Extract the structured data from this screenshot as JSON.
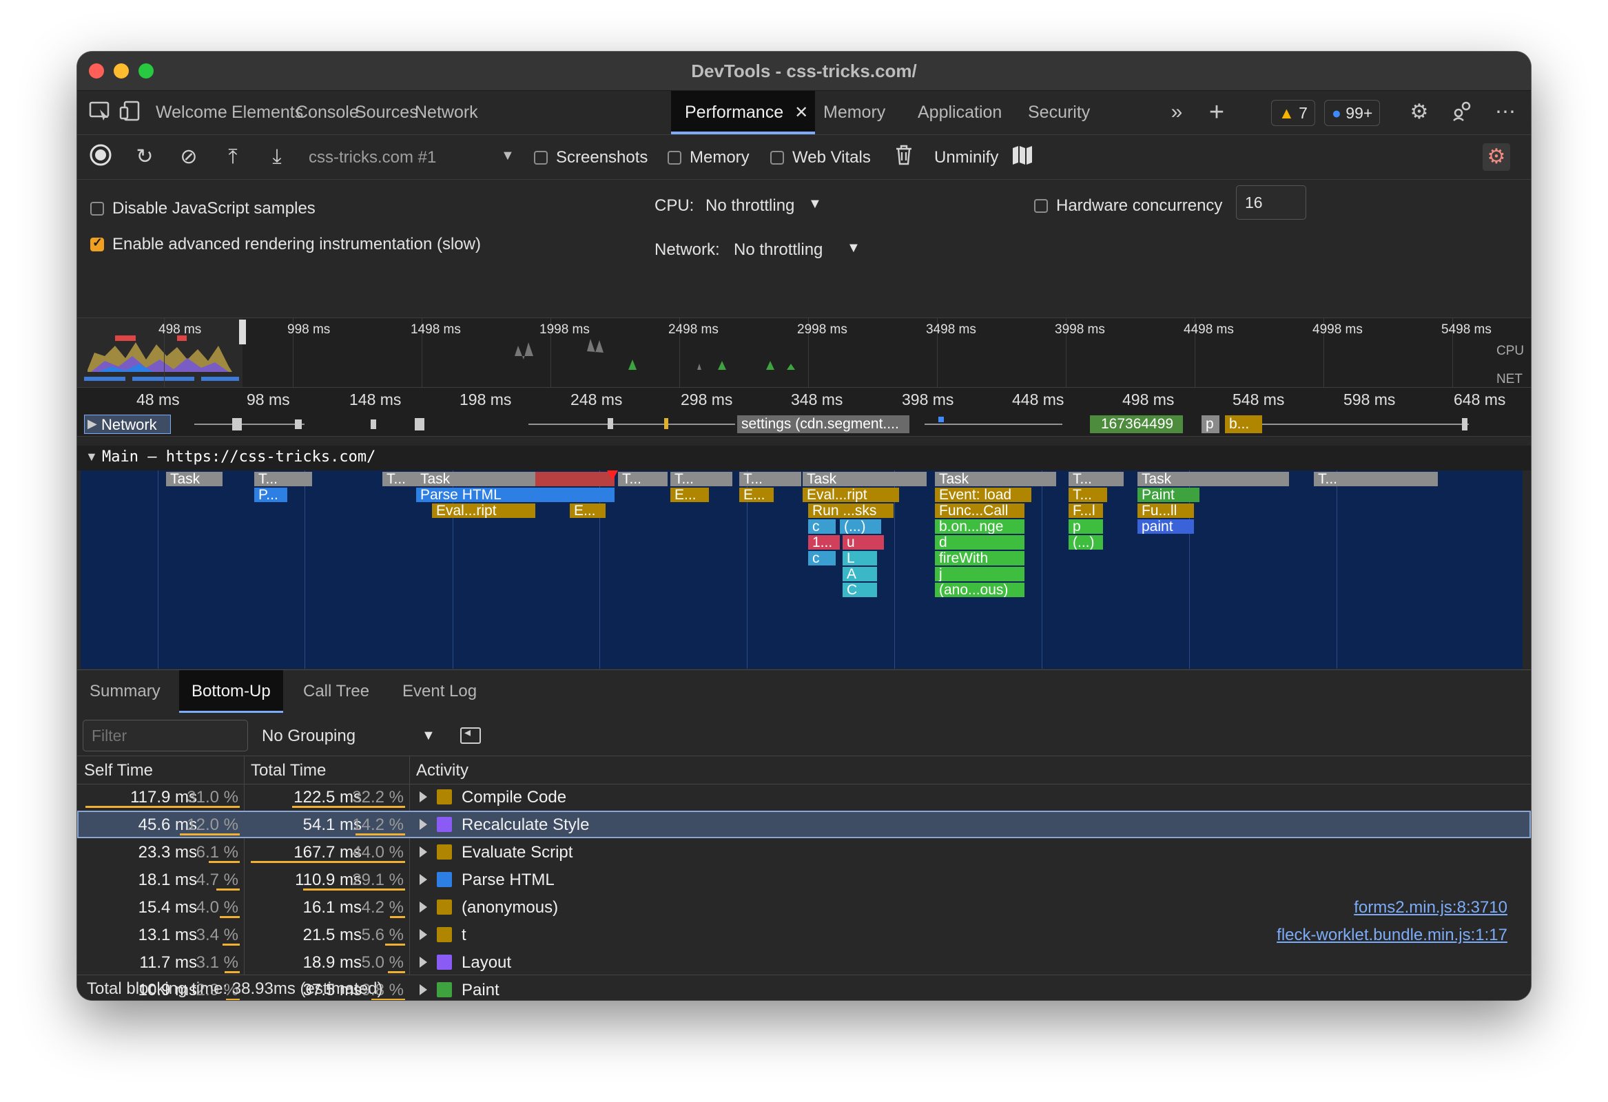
{
  "window": {
    "title": "DevTools - css-tricks.com/"
  },
  "tabs": [
    {
      "label": "Welcome"
    },
    {
      "label": "Elements"
    },
    {
      "label": "Console"
    },
    {
      "label": "Sources"
    },
    {
      "label": "Network"
    },
    {
      "label": "Performance"
    },
    {
      "label": "Memory"
    },
    {
      "label": "Application"
    },
    {
      "label": "Security"
    }
  ],
  "badges": {
    "warnings": "7",
    "messages": "99+"
  },
  "toolbar": {
    "profile_select": "css-tricks.com #1",
    "screenshots": "Screenshots",
    "memory": "Memory",
    "web_vitals": "Web Vitals",
    "unminify": "Unminify"
  },
  "settings": {
    "disable_js_samples": "Disable JavaScript samples",
    "advanced_rendering": "Enable advanced rendering instrumentation (slow)",
    "cpu_label": "CPU:",
    "cpu_value": "No throttling",
    "network_label": "Network:",
    "network_value": "No throttling",
    "hw_concurrency_label": "Hardware concurrency",
    "hw_concurrency_value": "16"
  },
  "overview": {
    "ticks": [
      "498 ms",
      "998 ms",
      "1498 ms",
      "1998 ms",
      "2498 ms",
      "2998 ms",
      "3498 ms",
      "3998 ms",
      "4498 ms",
      "4998 ms",
      "5498 ms"
    ],
    "cpu_label": "CPU",
    "net_label": "NET"
  },
  "ruler": {
    "ticks": [
      "48 ms",
      "98 ms",
      "148 ms",
      "198 ms",
      "248 ms",
      "298 ms",
      "348 ms",
      "398 ms",
      "448 ms",
      "498 ms",
      "548 ms",
      "598 ms",
      "648 ms"
    ]
  },
  "network_track": {
    "label": "Network",
    "items": [
      "settings (cdn.segment....",
      "167364499",
      "p",
      "b..."
    ]
  },
  "main_track": {
    "label": "Main — https://css-tricks.com/",
    "blocks": [
      {
        "label": "Task",
        "color": "#8c8c8c"
      },
      {
        "label": "T...",
        "color": "#8c8c8c"
      },
      {
        "label": "T...",
        "color": "#8c8c8c"
      },
      {
        "label": "Task",
        "color": "#8c8c8c"
      },
      {
        "label": "T...",
        "color": "#8c8c8c"
      },
      {
        "label": "T...",
        "color": "#8c8c8c"
      },
      {
        "label": "T...",
        "color": "#8c8c8c"
      },
      {
        "label": "Task",
        "color": "#8c8c8c"
      },
      {
        "label": "Task",
        "color": "#8c8c8c"
      },
      {
        "label": "T...",
        "color": "#8c8c8c"
      },
      {
        "label": "Task",
        "color": "#8c8c8c"
      },
      {
        "label": "T...",
        "color": "#8c8c8c"
      },
      {
        "label": "P...",
        "color": "#2d7fe3"
      },
      {
        "label": "Parse HTML",
        "color": "#2d7fe3"
      },
      {
        "label": "E...",
        "color": "#b08600"
      },
      {
        "label": "E...",
        "color": "#b08600"
      },
      {
        "label": "Eval...ript",
        "color": "#b08600"
      },
      {
        "label": "Event: load",
        "color": "#b08600"
      },
      {
        "label": "T...",
        "color": "#b08600"
      },
      {
        "label": "Paint",
        "color": "#3ea23e"
      },
      {
        "label": "Eval...ript",
        "color": "#b08600"
      },
      {
        "label": "E...",
        "color": "#b08600"
      },
      {
        "label": "Run ...sks",
        "color": "#b08600"
      },
      {
        "label": "Func...Call",
        "color": "#b08600"
      },
      {
        "label": "F...l",
        "color": "#b08600"
      },
      {
        "label": "Fu...ll",
        "color": "#b08600"
      },
      {
        "label": "c",
        "color": "#3a9fd0"
      },
      {
        "label": "(...)",
        "color": "#3a9fd0"
      },
      {
        "label": "b.on...nge",
        "color": "#3ebd3e"
      },
      {
        "label": "p",
        "color": "#3ebd3e"
      },
      {
        "label": "paint",
        "color": "#3b63d9"
      },
      {
        "label": "1...",
        "color": "#d0405a"
      },
      {
        "label": "u",
        "color": "#d0405a"
      },
      {
        "label": "d",
        "color": "#3ebd3e"
      },
      {
        "label": "(...)",
        "color": "#3ebd3e"
      },
      {
        "label": "c",
        "color": "#3a9fd0"
      },
      {
        "label": "L",
        "color": "#3ab8c8"
      },
      {
        "label": "fireWith",
        "color": "#3ebd3e"
      },
      {
        "label": "A",
        "color": "#3ab8c8"
      },
      {
        "label": "j",
        "color": "#3ebd3e"
      },
      {
        "label": "C",
        "color": "#3ab8c8"
      },
      {
        "label": "(ano...ous)",
        "color": "#3ebd3e"
      }
    ]
  },
  "panel": {
    "tabs": [
      {
        "label": "Summary"
      },
      {
        "label": "Bottom-Up"
      },
      {
        "label": "Call Tree"
      },
      {
        "label": "Event Log"
      }
    ],
    "filter_placeholder": "Filter",
    "grouping": "No Grouping",
    "columns": {
      "self": "Self Time",
      "total": "Total Time",
      "activity": "Activity"
    },
    "rows": [
      {
        "self_ms": "117.9 ms",
        "self_pct": "31.0 %",
        "total_ms": "122.5 ms",
        "total_pct": "32.2 %",
        "activity": "Compile Code",
        "color": "#b08600",
        "link": "",
        "self_frac": 1.0,
        "total_frac": 0.73
      },
      {
        "self_ms": "45.6 ms",
        "self_pct": "12.0 %",
        "total_ms": "54.1 ms",
        "total_pct": "14.2 %",
        "activity": "Recalculate Style",
        "color": "#8a5cf5",
        "link": "",
        "self_frac": 0.39,
        "total_frac": 0.32
      },
      {
        "self_ms": "23.3 ms",
        "self_pct": "6.1 %",
        "total_ms": "167.7 ms",
        "total_pct": "44.0 %",
        "activity": "Evaluate Script",
        "color": "#b08600",
        "link": "",
        "self_frac": 0.2,
        "total_frac": 1.0
      },
      {
        "self_ms": "18.1 ms",
        "self_pct": "4.7 %",
        "total_ms": "110.9 ms",
        "total_pct": "29.1 %",
        "activity": "Parse HTML",
        "color": "#2d7fe3",
        "link": "",
        "self_frac": 0.15,
        "total_frac": 0.66
      },
      {
        "self_ms": "15.4 ms",
        "self_pct": "4.0 %",
        "total_ms": "16.1 ms",
        "total_pct": "4.2 %",
        "activity": "(anonymous)",
        "color": "#b08600",
        "link": "forms2.min.js:8:3710",
        "self_frac": 0.13,
        "total_frac": 0.1
      },
      {
        "self_ms": "13.1 ms",
        "self_pct": "3.4 %",
        "total_ms": "21.5 ms",
        "total_pct": "5.6 %",
        "activity": "t",
        "color": "#b08600",
        "link": "fleck-worklet.bundle.min.js:1:17",
        "self_frac": 0.11,
        "total_frac": 0.13
      },
      {
        "self_ms": "11.7 ms",
        "self_pct": "3.1 %",
        "total_ms": "18.9 ms",
        "total_pct": "5.0 %",
        "activity": "Layout",
        "color": "#8a5cf5",
        "link": "",
        "self_frac": 0.1,
        "total_frac": 0.11
      },
      {
        "self_ms": "10.9 ms",
        "self_pct": "2.9 %",
        "total_ms": "37.5 ms",
        "total_pct": "9.8 %",
        "activity": "Paint",
        "color": "#3ea23e",
        "link": "",
        "self_frac": 0.09,
        "total_frac": 0.22
      }
    ],
    "footer": "Total blocking time: 38.93ms (estimated)"
  }
}
